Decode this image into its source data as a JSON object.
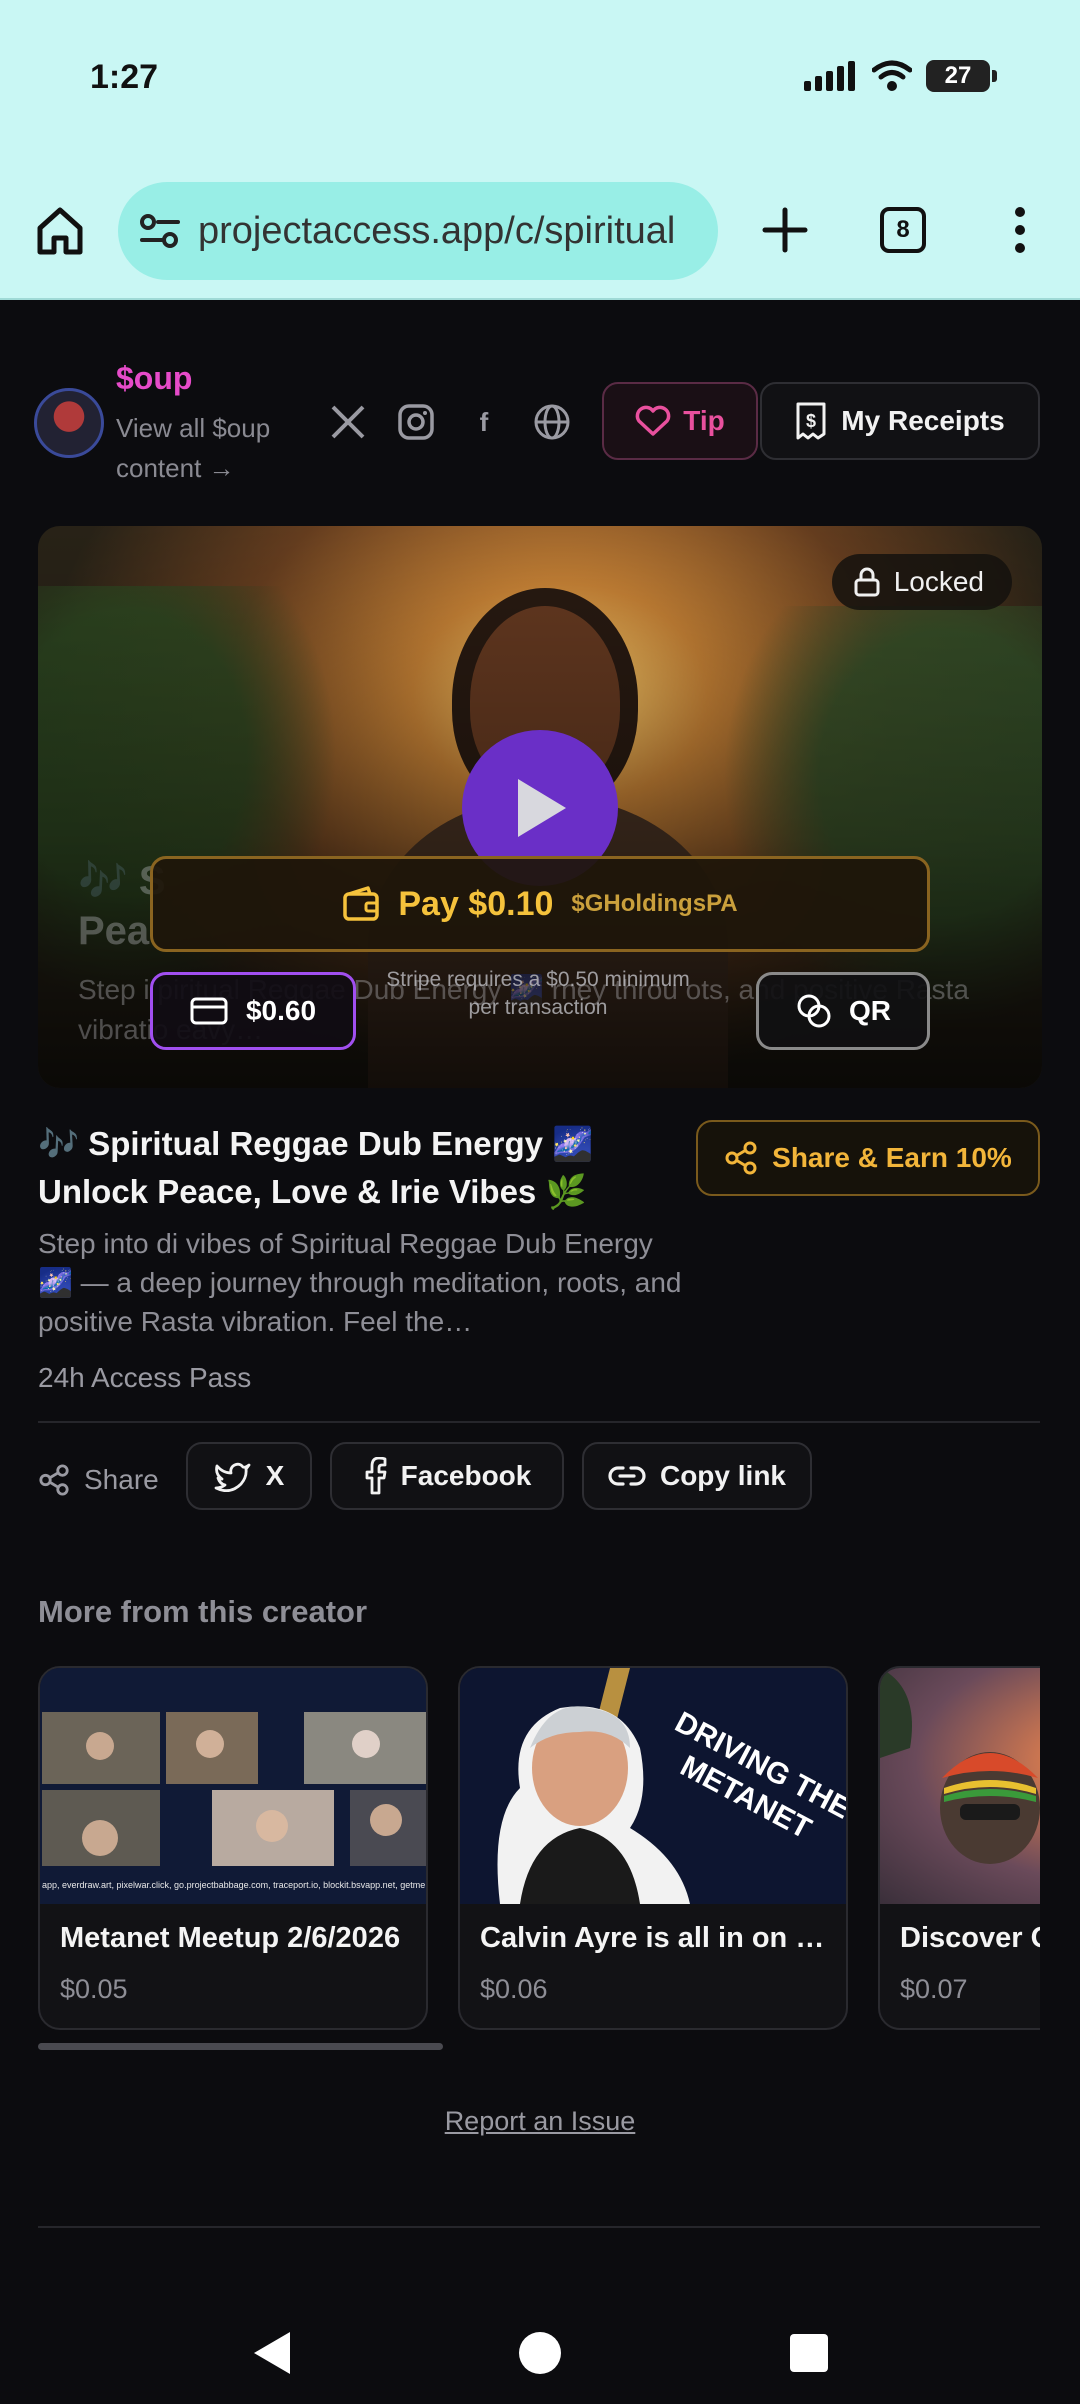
{
  "status_bar": {
    "time": "1:27",
    "battery": "27"
  },
  "browser": {
    "url": "projectaccess.app/c/spiritual",
    "tab_count": "8"
  },
  "creator": {
    "name": "$oup",
    "view_all": "View all $oup content →",
    "socials": [
      "x-icon",
      "instagram-icon",
      "facebook-icon",
      "globe-icon"
    ],
    "tip_label": "Tip",
    "receipts_label": "My Receipts"
  },
  "video": {
    "locked_label": "Locked",
    "overlay_title_line1": "🎶 S",
    "overlay_title_line2": "Pea",
    "overlay_desc": "Step i                                  piritual Reggae Dub Energy 🌌                       rney throu                     ots, and positive Rasta vibratio                   eavy…",
    "pay_label": "Pay $0.10",
    "pay_handle": "$GHoldingsPA",
    "stripe_note": "Stripe requires a $0.50 minimum per transaction",
    "card_amount": "$0.60",
    "qr_label": "QR"
  },
  "content": {
    "title": "🎶 Spiritual Reggae Dub Energy 🌌 Unlock Peace, Love & Irie Vibes 🌿",
    "description": "Step into di vibes of Spiritual Reggae Dub Energy 🌌 — a deep journey through meditation, roots, and positive Rasta vibration. Feel the…",
    "access_pass": "24h Access Pass",
    "share_earn_label": "Share & Earn 10%"
  },
  "share": {
    "label": "Share",
    "x_label": "X",
    "facebook_label": "Facebook",
    "copy_label": "Copy link"
  },
  "more": {
    "heading": "More from this creator",
    "items": [
      {
        "title": "Metanet Meetup 2/6/2026",
        "price": "$0.05"
      },
      {
        "title": "Calvin Ayre is all in on Metanet",
        "price": "$0.06"
      },
      {
        "title": "Discover O",
        "price": "$0.07"
      }
    ],
    "thumb2_text": "DRIVING THE METANET",
    "thumb1_caption": "app, everdraw.art, pixelwar.click, go.projectbabbage.com, traceport.io, blockit.bsvapp.net, getme"
  },
  "footer": {
    "report_label": "Report an Issue"
  },
  "colors": {
    "accent_pink": "#e64bc9",
    "gold": "#f5c23c",
    "purple": "#6a2fc7",
    "status_bg": "#c9f7f4"
  }
}
